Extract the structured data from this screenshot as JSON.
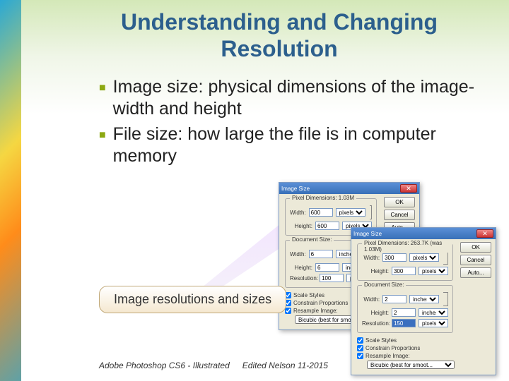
{
  "title": "Understanding and Changing Resolution",
  "bullets": [
    "Image size: physical dimensions of the image-width and height",
    "File size: how large the file is in computer memory"
  ],
  "callout": "Image resolutions and sizes",
  "footer_left": "Adobe Photoshop CS6 - Illustrated",
  "footer_right": "Edited Nelson 11-2015",
  "dialog1": {
    "title": "Image Size",
    "pixel_dim_label": "Pixel Dimensions: 1.03M",
    "width_label": "Width:",
    "width_val": "600",
    "width_unit": "pixels",
    "height_label": "Height:",
    "height_val": "600",
    "height_unit": "pixels",
    "doc_label": "Document Size:",
    "dwidth_val": "6",
    "dheight_val": "6",
    "dunit": "inches",
    "res_label": "Resolution:",
    "res_val": "100",
    "res_unit": "pixels/inch",
    "chk_styles": "Scale Styles",
    "chk_constrain": "Constrain Proportions",
    "chk_resample": "Resample Image:",
    "resample_sel": "Bicubic (best for smoot...",
    "ok": "OK",
    "cancel": "Cancel",
    "auto": "Auto..."
  },
  "dialog2": {
    "title": "Image Size",
    "pixel_dim_label": "Pixel Dimensions: 263.7K (was 1.03M)",
    "width_val": "300",
    "height_val": "300",
    "unit": "pixels",
    "doc_label": "Document Size:",
    "dwidth_val": "2",
    "dheight_val": "2",
    "dunit": "inches",
    "res_val": "150",
    "res_unit": "pixels/inch",
    "resample_sel": "Bicubic (best for smoot...",
    "ok": "OK",
    "cancel": "Cancel",
    "auto": "Auto..."
  }
}
